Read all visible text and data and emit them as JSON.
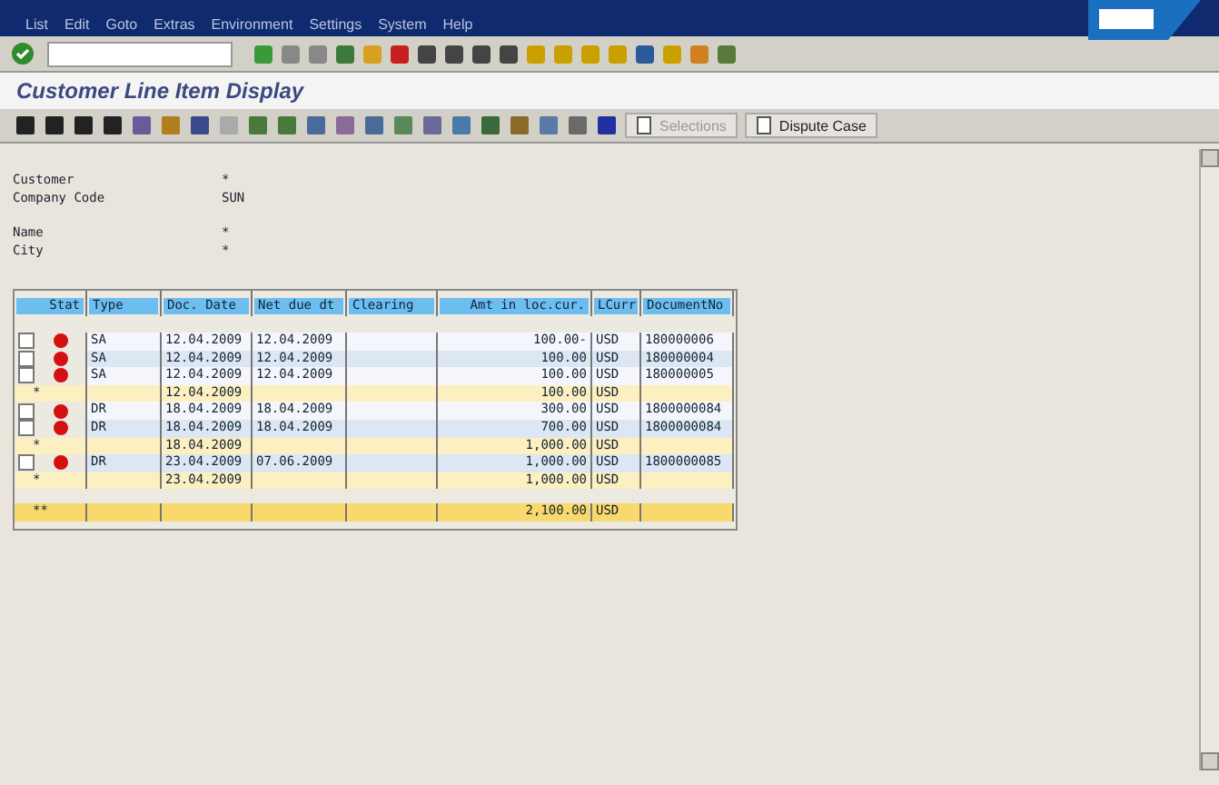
{
  "menu": [
    "List",
    "Edit",
    "Goto",
    "Extras",
    "Environment",
    "Settings",
    "System",
    "Help"
  ],
  "title": "Customer Line Item Display",
  "app_toolbar": {
    "buttons": [
      {
        "label": "Selections",
        "disabled": true
      },
      {
        "label": "Dispute Case",
        "disabled": false
      }
    ]
  },
  "header_groups": [
    [
      {
        "label": "Customer",
        "value": "*"
      },
      {
        "label": "Company Code",
        "value": "SUN"
      }
    ],
    [
      {
        "label": "Name",
        "value": "*"
      },
      {
        "label": "City",
        "value": "*"
      }
    ]
  ],
  "table": {
    "columns": [
      "Stat",
      "Type",
      "Doc. Date",
      "Net due dt",
      "Clearing",
      "Amt in loc.cur.",
      "LCurr",
      "DocumentNo"
    ],
    "rows": [
      {
        "kind": "item",
        "checked": false,
        "cells": [
          "",
          "SA",
          "12.04.2009",
          "12.04.2009",
          "",
          "100.00-",
          "USD",
          "180000006"
        ]
      },
      {
        "kind": "item",
        "checked": false,
        "cells": [
          "",
          "SA",
          "12.04.2009",
          "12.04.2009",
          "",
          "100.00",
          "USD",
          "180000004"
        ]
      },
      {
        "kind": "item",
        "checked": false,
        "cells": [
          "",
          "SA",
          "12.04.2009",
          "12.04.2009",
          "",
          "100.00",
          "USD",
          "180000005"
        ]
      },
      {
        "kind": "subtotal",
        "mark": "*",
        "cells": [
          "",
          "",
          "12.04.2009",
          "",
          "",
          "100.00",
          "USD",
          ""
        ]
      },
      {
        "kind": "item",
        "checked": false,
        "cells": [
          "",
          "DR",
          "18.04.2009",
          "18.04.2009",
          "",
          "300.00",
          "USD",
          "1800000084"
        ]
      },
      {
        "kind": "item",
        "checked": false,
        "cells": [
          "",
          "DR",
          "18.04.2009",
          "18.04.2009",
          "",
          "700.00",
          "USD",
          "1800000084"
        ]
      },
      {
        "kind": "subtotal",
        "mark": "*",
        "cells": [
          "",
          "",
          "18.04.2009",
          "",
          "",
          "1,000.00",
          "USD",
          ""
        ]
      },
      {
        "kind": "item",
        "checked": false,
        "cells": [
          "",
          "DR",
          "23.04.2009",
          "07.06.2009",
          "",
          "1,000.00",
          "USD",
          "1800000085"
        ]
      },
      {
        "kind": "subtotal",
        "mark": "*",
        "cells": [
          "",
          "",
          "23.04.2009",
          "",
          "",
          "1,000.00",
          "USD",
          ""
        ]
      },
      {
        "kind": "total",
        "mark": "**",
        "cells": [
          "",
          "",
          "",
          "",
          "",
          "2,100.00",
          "USD",
          ""
        ]
      }
    ]
  }
}
